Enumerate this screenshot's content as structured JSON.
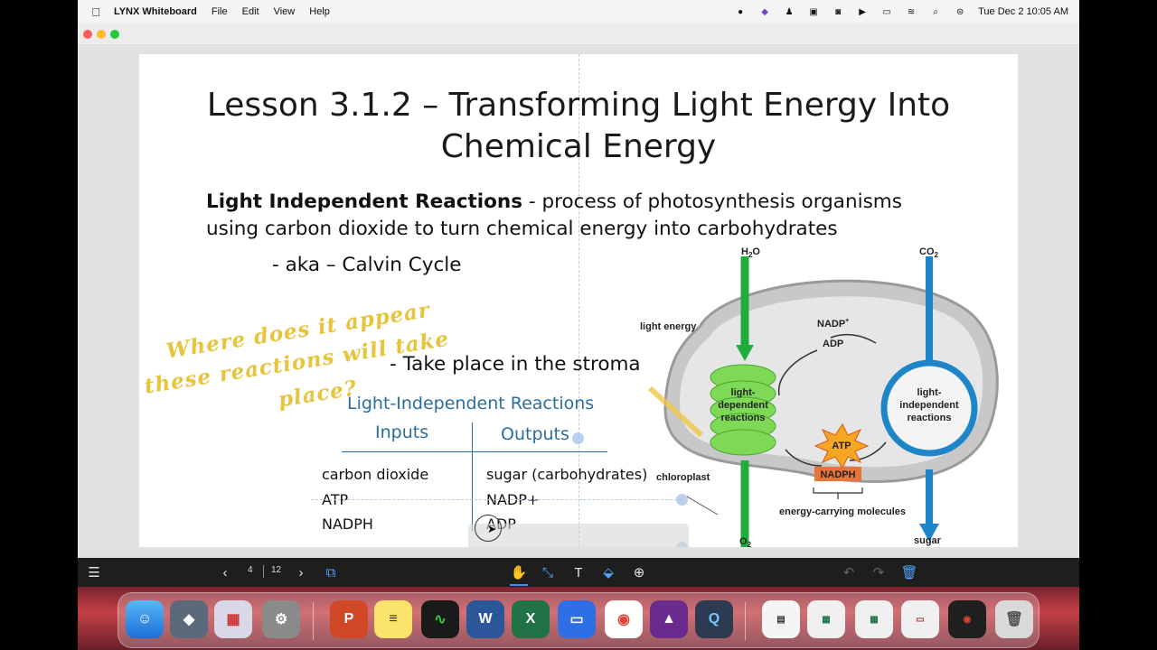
{
  "menubar": {
    "app_name": "LYNX Whiteboard",
    "menus": [
      "File",
      "Edit",
      "View",
      "Help"
    ],
    "clock": "Tue Dec 2  10:05 AM"
  },
  "slide": {
    "title_line1": "Lesson 3.1.2 – Transforming Light Energy Into",
    "title_line2": "Chemical Energy",
    "definition_term": "Light Independent Reactions",
    "definition_rest": " - process of photosynthesis organisms",
    "definition_line2": "using carbon dioxide to turn chemical energy into carbohydrates",
    "aka": "- aka – Calvin Cycle",
    "location": "- Take place in the stroma",
    "handwriting": [
      "Where does it appear",
      "these reactions will take",
      "place?"
    ],
    "table": {
      "title": "Light-Independent Reactions",
      "headers": [
        "Inputs",
        "Outputs"
      ],
      "inputs": [
        "carbon dioxide",
        "ATP",
        "NADPH"
      ],
      "outputs": [
        "sugar (carbohydrates)",
        "NADP+",
        "ADP"
      ]
    }
  },
  "diagram": {
    "h2o": "H",
    "h2o_sub": "2",
    "h2o_o": "O",
    "co2": "CO",
    "co2_sub": "2",
    "light_energy": "light energy",
    "nadp_plus": "NADP",
    "nadp_sup": "+",
    "adp": "ADP",
    "light_dependent": [
      "light-",
      "dependent",
      "reactions"
    ],
    "light_independent": [
      "light-",
      "independent",
      "reactions"
    ],
    "atp": "ATP",
    "nadph": "NADPH",
    "chloroplast": "chloroplast",
    "energy_carrying": "energy-carrying molecules",
    "o2": "O",
    "o2_sub": "2",
    "sugar": "sugar",
    "colors": {
      "green": "#1fae3c",
      "blue": "#1e86c8",
      "atp": "#f5a623",
      "nadph": "#e8743b"
    }
  },
  "toolbar": {
    "page_current": "4",
    "page_total": "12"
  }
}
